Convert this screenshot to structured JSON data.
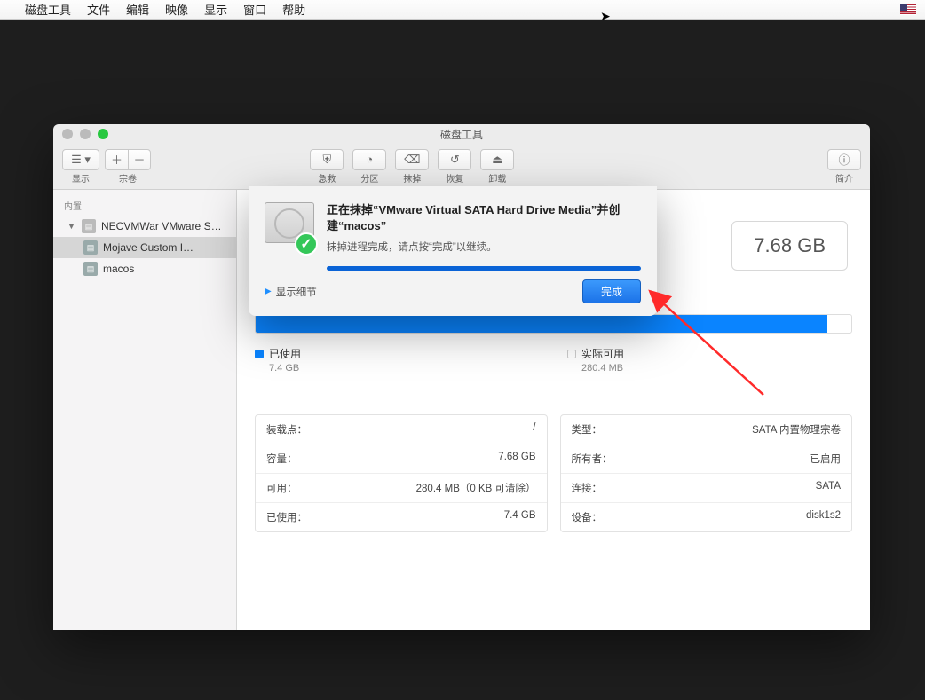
{
  "menubar": {
    "app": "磁盘工具",
    "items": [
      "文件",
      "编辑",
      "映像",
      "显示",
      "窗口",
      "帮助"
    ]
  },
  "window": {
    "title": "磁盘工具",
    "toolbar": {
      "view_label": "显示",
      "volume_label": "宗卷",
      "firstaid": "急救",
      "partition": "分区",
      "erase": "抹掉",
      "restore": "恢复",
      "unmount": "卸载",
      "info": "简介"
    }
  },
  "sidebar": {
    "header": "内置",
    "disk": "NECVMWar VMware S…",
    "volume": "Mojave Custom I…",
    "sub": "macos"
  },
  "main": {
    "capacity": "7.68 GB",
    "legend_used": "已使用",
    "legend_used_val": "7.4 GB",
    "legend_free": "实际可用",
    "legend_free_val": "280.4 MB",
    "left": [
      {
        "k": "装载点：",
        "v": "/"
      },
      {
        "k": "容量：",
        "v": "7.68 GB"
      },
      {
        "k": "可用：",
        "v": "280.4 MB（0 KB 可清除）"
      },
      {
        "k": "已使用：",
        "v": "7.4 GB"
      }
    ],
    "right": [
      {
        "k": "类型：",
        "v": "SATA 内置物理宗卷"
      },
      {
        "k": "所有者：",
        "v": "已启用"
      },
      {
        "k": "连接：",
        "v": "SATA"
      },
      {
        "k": "设备：",
        "v": "disk1s2"
      }
    ]
  },
  "sheet": {
    "title": "正在抹掉“VMware Virtual SATA Hard Drive Media”并创建“macos”",
    "subtitle": "抹掉进程完成，请点按“完成”以继续。",
    "details": "显示细节",
    "done": "完成"
  }
}
